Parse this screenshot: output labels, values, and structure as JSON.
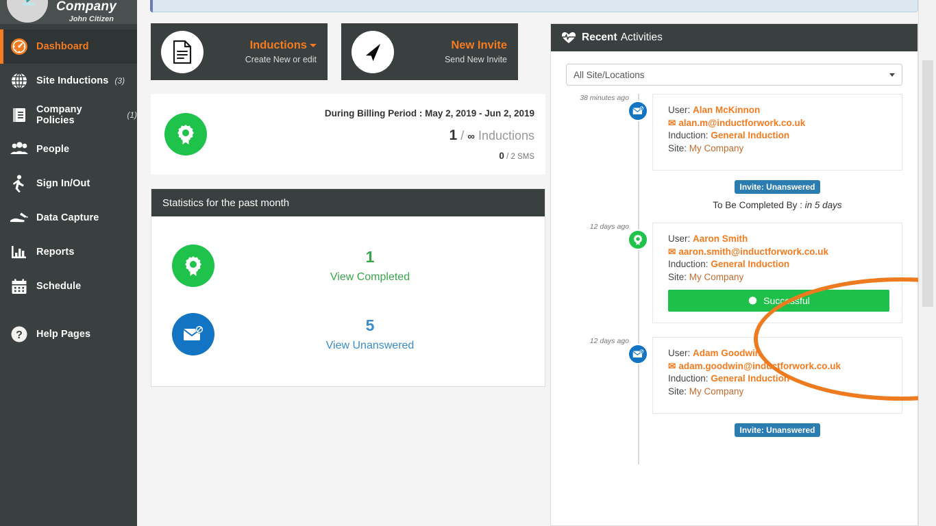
{
  "sidebar": {
    "company": "Company",
    "user": "John Citizen",
    "avatar_icon": "user-avatar",
    "items": [
      {
        "label": "Dashboard",
        "icon": "dashboard-gauge-icon",
        "count": "",
        "active": true
      },
      {
        "label": "Site Inductions",
        "icon": "globe-icon",
        "count": "(3)",
        "active": false
      },
      {
        "label": "Company Policies",
        "icon": "book-icon",
        "count": "(1)",
        "active": false
      },
      {
        "label": "People",
        "icon": "people-icon",
        "count": "",
        "active": false
      },
      {
        "label": "Sign In/Out",
        "icon": "walking-person-icon",
        "count": "",
        "active": false
      },
      {
        "label": "Data Capture",
        "icon": "hand-pen-icon",
        "count": "",
        "active": false
      },
      {
        "label": "Reports",
        "icon": "bar-chart-icon",
        "count": "",
        "active": false
      },
      {
        "label": "Schedule",
        "icon": "calendar-icon",
        "count": "",
        "active": false
      },
      {
        "label": "Help Pages",
        "icon": "question-circle-icon",
        "count": "",
        "active": false
      }
    ]
  },
  "quick_actions": [
    {
      "title": "Inductions",
      "subtitle": "Create New or edit",
      "icon": "document-icon",
      "has_caret": true
    },
    {
      "title": "New Invite",
      "subtitle": "Send New Invite",
      "icon": "paper-plane-icon",
      "has_caret": false
    }
  ],
  "billing": {
    "icon": "award-ribbon-icon",
    "period_label": "During Billing Period : May 2, 2019 - Jun 2, 2019",
    "inductions_used": "1",
    "inductions_limit": "∞",
    "inductions_label": "Inductions",
    "sms_used": "0",
    "sms_limit": "/ 2 SMS"
  },
  "statistics": {
    "title": "Statistics for the past month",
    "rows": [
      {
        "icon": "award-ribbon-icon",
        "value": "1",
        "link": "View Completed",
        "color": "green"
      },
      {
        "icon": "mail-blocked-icon",
        "value": "5",
        "link": "View Unanswered",
        "color": "blue"
      }
    ]
  },
  "recent_activities": {
    "title_bold": "Recent",
    "title_rest": "Activities",
    "header_icon": "heartbeat-icon",
    "site_filter_value": "All Site/Locations",
    "labels": {
      "user": "User:",
      "induction": "Induction:",
      "site": "Site:",
      "due_prefix": "To Be Completed By :"
    },
    "items": [
      {
        "time": "38 minutes ago",
        "dot_icon": "mail-blocked-icon",
        "dot_color": "blue",
        "user": "Alan McKinnon",
        "email": "alan.m@inductforwork.co.uk",
        "induction": "General Induction",
        "site": "My Company",
        "status": null,
        "badge": "Invite: Unanswered",
        "due": "in 5 days"
      },
      {
        "time": "12 days ago",
        "dot_icon": "award-ribbon-icon",
        "dot_color": "green",
        "user": "Aaron  Smith",
        "email": "aaron.smith@inductforwork.co.uk",
        "induction": "General Induction",
        "site": "My Company",
        "status": "Successful",
        "status_icon": "badge-seal-icon",
        "badge": null,
        "due": null
      },
      {
        "time": "12 days ago",
        "dot_icon": "mail-blocked-icon",
        "dot_color": "blue",
        "user": "Adam Goodwin",
        "email": "adam.goodwin@inductforwork.co.uk",
        "induction": "General Induction",
        "site": "My Company",
        "status": null,
        "badge": "Invite: Unanswered",
        "due": null
      }
    ]
  },
  "colors": {
    "accent_orange": "#f47b20",
    "dark_panel": "#3a3f3f",
    "green": "#1fc24b",
    "blue": "#1374c4",
    "badge_blue": "#2b7cb0",
    "highlight_ring": "#ee7b20"
  }
}
